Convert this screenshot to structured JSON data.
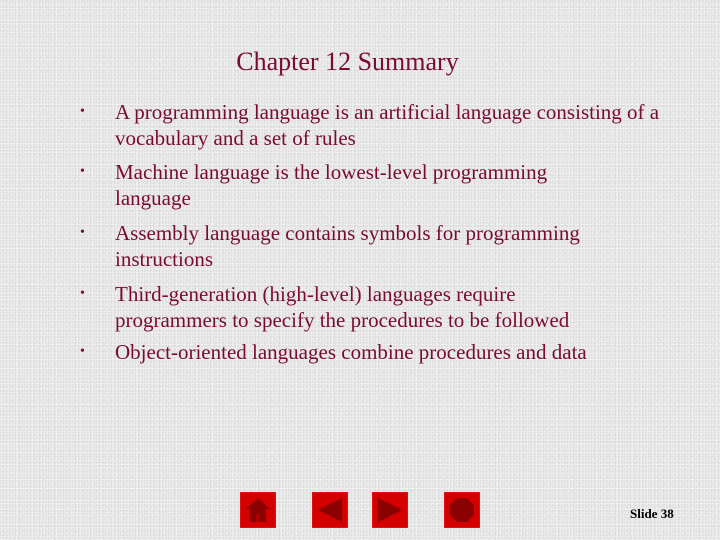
{
  "slide": {
    "title": "Chapter 12 Summary",
    "bullets": [
      {
        "text": "A programming language is an artificial language consisting of a vocabulary and a set of rules"
      },
      {
        "text": "Machine language is the lowest-level programming language"
      },
      {
        "text": "Assembly language contains symbols for programming instructions"
      },
      {
        "text": "Third-generation (high-level) languages require programmers to specify the procedures to be followed"
      },
      {
        "text": "Object-oriented languages combine procedures and data"
      }
    ],
    "bullet_glyph": "•",
    "slide_number_label": "Slide 38"
  },
  "navigation": {
    "buttons": [
      {
        "name": "home",
        "icon": "home-icon",
        "title": "Home"
      },
      {
        "name": "back",
        "icon": "arrow-left-icon",
        "title": "Previous"
      },
      {
        "name": "forward",
        "icon": "arrow-right-icon",
        "title": "Next"
      },
      {
        "name": "end",
        "icon": "stop-icon",
        "title": "End"
      }
    ]
  },
  "colors": {
    "text": "#7a0a2e",
    "nav_button": "#d40000",
    "nav_glyph": "#8b0000",
    "background": "#ececec"
  }
}
